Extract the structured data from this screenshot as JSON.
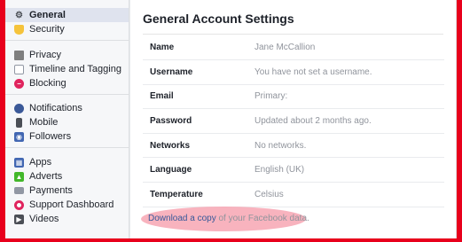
{
  "sidebar": {
    "groups": [
      {
        "items": [
          {
            "label": "General",
            "icon": "gear-icon",
            "selected": true
          },
          {
            "label": "Security",
            "icon": "shield-icon"
          }
        ]
      },
      {
        "items": [
          {
            "label": "Privacy",
            "icon": "lock-icon"
          },
          {
            "label": "Timeline and Tagging",
            "icon": "timeline-icon"
          },
          {
            "label": "Blocking",
            "icon": "block-icon"
          }
        ]
      },
      {
        "items": [
          {
            "label": "Notifications",
            "icon": "globe-icon"
          },
          {
            "label": "Mobile",
            "icon": "mobile-icon"
          },
          {
            "label": "Followers",
            "icon": "rss-icon"
          }
        ]
      },
      {
        "items": [
          {
            "label": "Apps",
            "icon": "apps-icon"
          },
          {
            "label": "Adverts",
            "icon": "adverts-icon"
          },
          {
            "label": "Payments",
            "icon": "card-icon"
          },
          {
            "label": "Support Dashboard",
            "icon": "lifebuoy-icon"
          },
          {
            "label": "Videos",
            "icon": "film-icon"
          }
        ]
      }
    ]
  },
  "main": {
    "title": "General Account Settings",
    "rows": [
      {
        "label": "Name",
        "value": "Jane McCallion"
      },
      {
        "label": "Username",
        "value": "You have not set a username."
      },
      {
        "label": "Email",
        "value": "Primary:"
      },
      {
        "label": "Password",
        "value": "Updated about 2 months ago."
      },
      {
        "label": "Networks",
        "value": "No networks."
      },
      {
        "label": "Language",
        "value": "English (UK)"
      },
      {
        "label": "Temperature",
        "value": "Celsius"
      }
    ],
    "download": {
      "link": "Download a copy",
      "rest": " of your Facebook data."
    }
  },
  "colors": {
    "frame": "#e8001c",
    "highlight": "#f7a6b3",
    "link": "#365899"
  }
}
